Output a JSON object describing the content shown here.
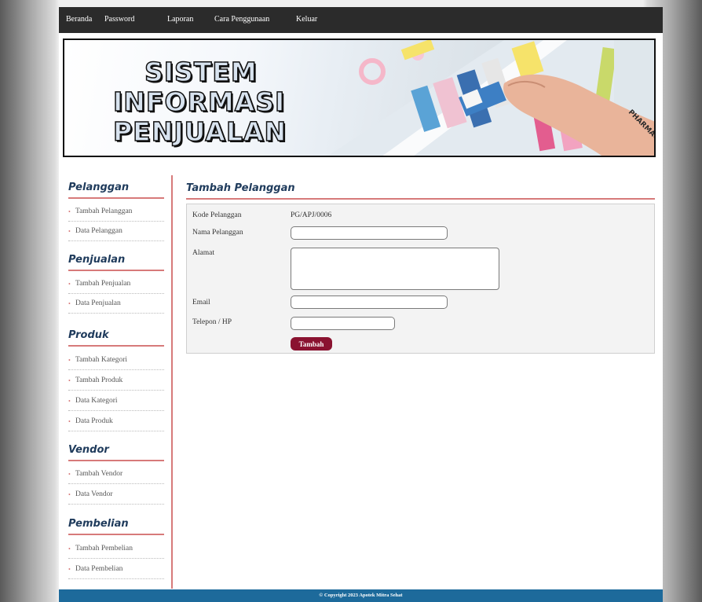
{
  "nav": {
    "items": [
      "Beranda",
      "Password",
      "Laporan",
      "Cara Penggunaan",
      "Keluar"
    ]
  },
  "banner": {
    "title_lines": [
      "SISTEM",
      "INFORMASI",
      "PENJUALAN"
    ]
  },
  "sidebar": {
    "sections": [
      {
        "title": "Pelanggan",
        "items": [
          "Tambah Pelanggan",
          "Data Pelanggan"
        ]
      },
      {
        "title": "Penjualan",
        "items": [
          "Tambah Penjualan",
          "Data Penjualan"
        ]
      },
      {
        "title": "Produk",
        "items": [
          "Tambah Kategori",
          "Tambah Produk",
          "Data Kategori",
          "Data Produk"
        ]
      },
      {
        "title": "Vendor",
        "items": [
          "Tambah Vendor",
          "Data Vendor"
        ]
      },
      {
        "title": "Pembelian",
        "items": [
          "Tambah Pembelian",
          "Data Pembelian"
        ]
      }
    ]
  },
  "content": {
    "title": "Tambah Pelanggan",
    "form": {
      "kode_label": "Kode Pelanggan",
      "kode_value": "PG/APJ/0006",
      "nama_label": "Nama Pelanggan",
      "nama_value": "",
      "alamat_label": "Alamat",
      "alamat_value": "",
      "email_label": "Email",
      "email_value": "",
      "telepon_label": "Telepon / HP",
      "telepon_value": "",
      "submit_label": "Tambah"
    }
  },
  "footer": {
    "text": "© Copyright 2023 Apotek Mitra Sehat"
  },
  "colors": {
    "nav_bg": "#2b2b2b",
    "accent_line": "#d77a7a",
    "heading": "#1f3b5c",
    "button": "#8a1230",
    "footer_bg": "#1d6a9b"
  }
}
